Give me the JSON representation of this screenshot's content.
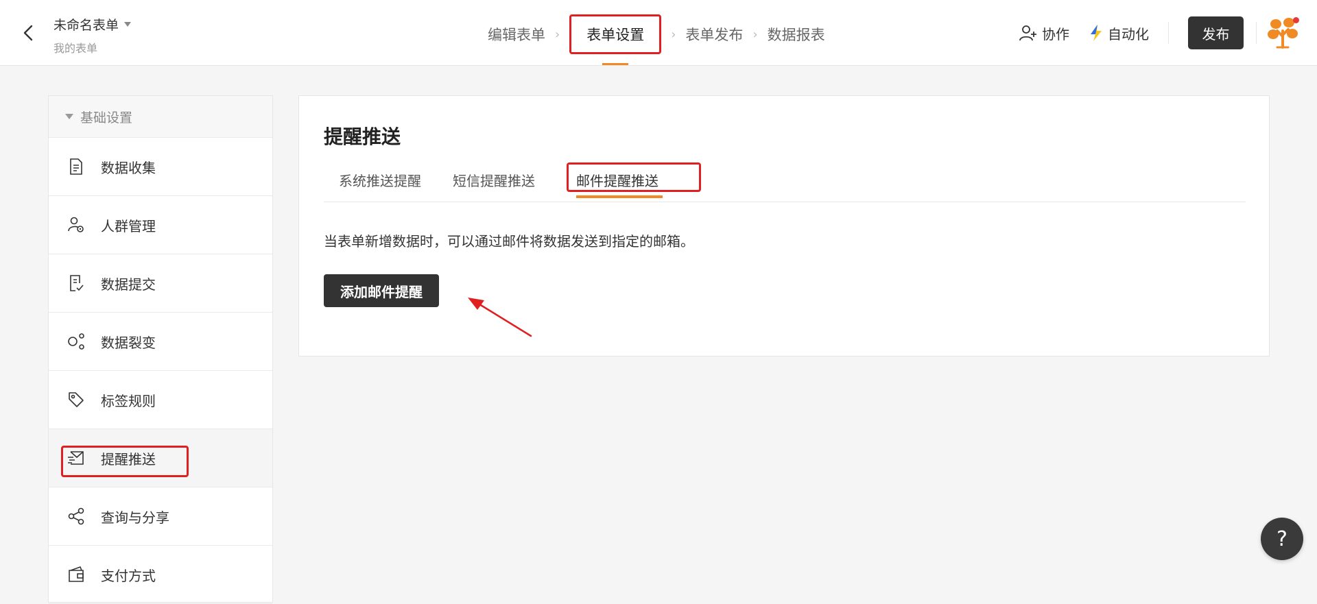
{
  "header": {
    "form_title": "未命名表单",
    "form_subtitle": "我的表单",
    "steps": [
      {
        "label": "编辑表单"
      },
      {
        "label": "表单设置"
      },
      {
        "label": "表单发布"
      },
      {
        "label": "数据报表"
      }
    ],
    "active_step": "表单设置",
    "collaborate_label": "协作",
    "automation_label": "自动化",
    "publish_label": "发布"
  },
  "sidebar": {
    "group_label": "基础设置",
    "items": [
      {
        "label": "数据收集",
        "icon": "document-icon"
      },
      {
        "label": "人群管理",
        "icon": "user-settings-icon"
      },
      {
        "label": "数据提交",
        "icon": "document-check-icon"
      },
      {
        "label": "数据裂变",
        "icon": "share-nodes-icon"
      },
      {
        "label": "标签规则",
        "icon": "tag-icon"
      },
      {
        "label": "提醒推送",
        "icon": "send-icon"
      },
      {
        "label": "查询与分享",
        "icon": "share-icon"
      },
      {
        "label": "支付方式",
        "icon": "wallet-icon"
      }
    ],
    "active_item": "提醒推送"
  },
  "panel": {
    "title": "提醒推送",
    "tabs": [
      {
        "label": "系统推送提醒"
      },
      {
        "label": "短信提醒推送"
      },
      {
        "label": "邮件提醒推送"
      }
    ],
    "active_tab": "邮件提醒推送",
    "description": "当表单新增数据时，可以通过邮件将数据发送到指定的邮箱。",
    "add_button_label": "添加邮件提醒"
  },
  "help": {
    "label": "?"
  },
  "colors": {
    "accent": "#f08a24",
    "highlight": "#e02020",
    "dark_button": "#333333"
  }
}
